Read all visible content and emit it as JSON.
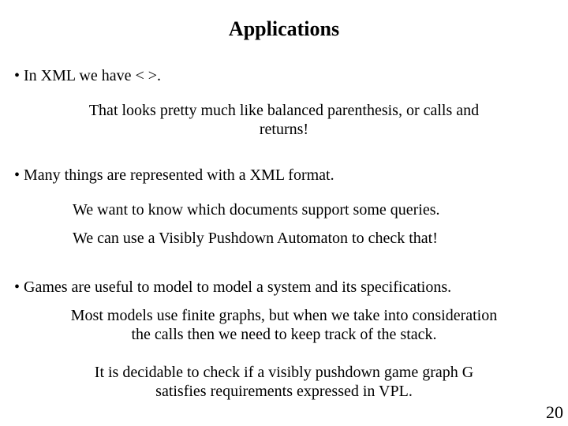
{
  "title": "Applications",
  "bullet1": "In XML we have < >.",
  "line1a": "That looks pretty much like balanced parenthesis, or calls and",
  "line1b": "returns!",
  "bullet2": "Many things are represented with a XML format.",
  "line2a": "We want to know which documents support some queries.",
  "line2b": "We can use a Visibly Pushdown Automaton to check that!",
  "bullet3": "Games are useful to model to model a system and its specifications.",
  "line3a": "Most models use finite graphs, but when we take into consideration",
  "line3b": "the calls then we need to keep track of the stack.",
  "line3c": "It is decidable to check if a visibly pushdown game graph G",
  "line3d": "satisfies requirements expressed in VPL.",
  "page_number": "20"
}
